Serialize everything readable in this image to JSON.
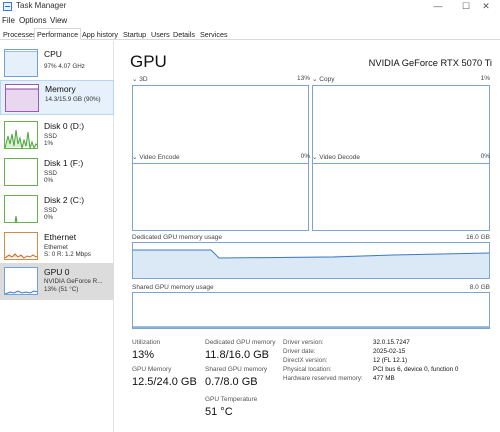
{
  "window": {
    "title": "Task Manager",
    "minimize": "—",
    "maximize": "☐",
    "close": "✕"
  },
  "menu": [
    "File",
    "Options",
    "View"
  ],
  "tabs": [
    "Processes",
    "Performance",
    "App history",
    "Startup",
    "Users",
    "Details",
    "Services"
  ],
  "active_tab": "Performance",
  "sidebar": {
    "items": [
      {
        "title": "CPU",
        "lines": [
          "97%  4.07 GHz"
        ]
      },
      {
        "title": "Memory",
        "lines": [
          "14.3/15.9 GB (90%)"
        ]
      },
      {
        "title": "Disk 0 (D:)",
        "lines": [
          "SSD",
          "1%"
        ]
      },
      {
        "title": "Disk 1 (F:)",
        "lines": [
          "SSD",
          "0%"
        ]
      },
      {
        "title": "Disk 2 (C:)",
        "lines": [
          "SSD",
          "0%"
        ]
      },
      {
        "title": "Ethernet",
        "lines": [
          "Ethernet",
          "S: 0  R: 1.2 Mbps"
        ]
      },
      {
        "title": "GPU 0",
        "lines": [
          "NVIDIA GeForce R...",
          "13% (51 °C)"
        ]
      }
    ],
    "selected": "GPU 0"
  },
  "main": {
    "title": "GPU",
    "model": "NVIDIA GeForce RTX 5070 Ti",
    "graphs": {
      "g3d": {
        "label": "3D",
        "pct": "13%"
      },
      "copy": {
        "label": "Copy",
        "pct": "1%"
      },
      "venc": {
        "label": "Video Encode",
        "pct": "0%"
      },
      "vdec": {
        "label": "Video Decode",
        "pct": "0%"
      }
    },
    "dedicated": {
      "label": "Dedicated GPU memory usage",
      "max": "16.0 GB"
    },
    "shared": {
      "label": "Shared GPU memory usage",
      "max": "8.0 GB"
    },
    "stats": {
      "utilization_label": "Utilization",
      "utilization": "13%",
      "dedicated_label": "Dedicated GPU memory",
      "dedicated": "11.8/16.0 GB",
      "gpu_memory_label": "GPU Memory",
      "gpu_memory": "12.5/24.0 GB",
      "shared_label": "Shared GPU memory",
      "shared": "0.7/8.0 GB",
      "temp_label": "GPU Temperature",
      "temp": "51 °C"
    },
    "info": [
      {
        "label": "Driver version:",
        "value": "32.0.15.7247"
      },
      {
        "label": "Driver date:",
        "value": "2025-02-15"
      },
      {
        "label": "DirectX version:",
        "value": "12 (FL 12.1)"
      },
      {
        "label": "Physical location:",
        "value": "PCI bus 6, device 0, function 0"
      },
      {
        "label": "Hardware reserved memory:",
        "value": "477 MB"
      }
    ]
  },
  "colors": {
    "gpu_line": "#3b7cc4",
    "mem_fill": "#dbe8f5",
    "disk": "#4aa33c",
    "ethernet": "#c66a1e",
    "memory": "#8b3c9f"
  }
}
